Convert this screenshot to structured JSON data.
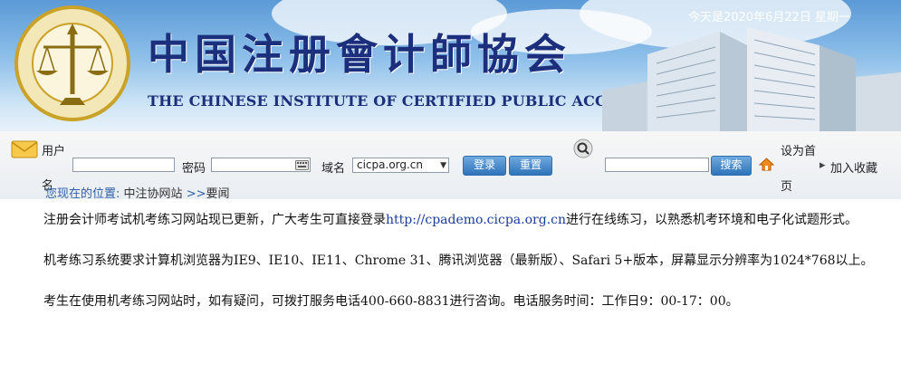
{
  "header": {
    "date_text": "今天是2020年6月22日 星期一",
    "title_cn": "中国注册會计師協会",
    "title_en": "THE CHINESE INSTITUTE OF CERTIFIED PUBLIC ACCOUNTANTS",
    "logo_text": "中国注册会计师协会"
  },
  "login": {
    "username_label": "用户",
    "username_label_2": "名",
    "password_label": "密码",
    "domain_label": "域名",
    "domain_value": "cicpa.org.cn",
    "login_button": "登录",
    "reset_button": "重置",
    "search_button": "搜索",
    "set_home_label": "设为首",
    "set_home_label_2": "页",
    "favorite_label": "加入收藏"
  },
  "breadcrumb": {
    "prefix": "您现在的位置:",
    "items": [
      "中注协网站",
      "要闻"
    ],
    "separator": ">>"
  },
  "content": {
    "p1_before": "注册会计师考试机考练习网站现已更新，广大考生可直接登录",
    "p1_link": "http://cpademo.cicpa.org.cn",
    "p1_after": "进行在线练习，以熟悉机考环境和电子化试题形式。",
    "p2": "机考练习系统要求计算机浏览器为IE9、IE10、IE11、Chrome 31、腾讯浏览器（最新版）、Safari 5+版本，屏幕显示分辨率为1024*768以上。",
    "p3": "考生在使用机考练习网站时，如有疑问，可拨打服务电话400-660-8831进行咨询。电话服务时间：工作日9：00-17：00。"
  },
  "colors": {
    "title_blue": "#1c2f7c",
    "button_blue": "#2f73b9",
    "link_blue": "#1a3d9c",
    "logo_gold": "#c9a227"
  }
}
